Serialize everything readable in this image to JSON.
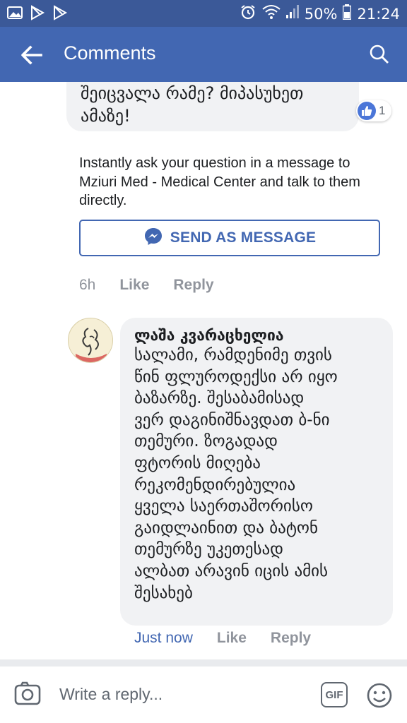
{
  "status_bar": {
    "battery": "50%",
    "time": "21:24"
  },
  "header": {
    "title": "Comments"
  },
  "comments": [
    {
      "text_lines": [
        "შეიცვალა რამე? მიპასუხეთ",
        "ამაზე!"
      ],
      "reaction_count": "1"
    },
    {
      "author": "ლაშა კვარაცხელია",
      "text_lines": [
        "სალამი, რამდენიმე თვის",
        "წინ ფლუროდექსი არ იყო",
        "ბაზარზე. შესაბამისად",
        "ვერ დაგინიშნავდათ ბ-ნი",
        "თემური. ზოგადად",
        "ფტორის მიღება",
        "რეკომენდირებულია",
        "ყველა საერთაშორისო",
        "გაიდლაინით და ბატონ",
        "თემურზე უკეთესად",
        "ალბათ არავინ იცის ამის",
        "შესახებ"
      ],
      "time": "Just now",
      "like": "Like",
      "reply": "Reply"
    }
  ],
  "bot_message": {
    "text": "Instantly ask your question in a message to Mziuri Med - Medical Center and talk to them directly.",
    "button": "SEND AS MESSAGE",
    "time": "6h",
    "like": "Like",
    "reply": "Reply"
  },
  "reply_bar": {
    "placeholder": "Write a reply...",
    "gif": "GIF"
  },
  "colors": {
    "brand": "#4267b2",
    "status_bar": "#3b5998",
    "bubble": "#f1f2f4",
    "muted": "#90949c"
  }
}
